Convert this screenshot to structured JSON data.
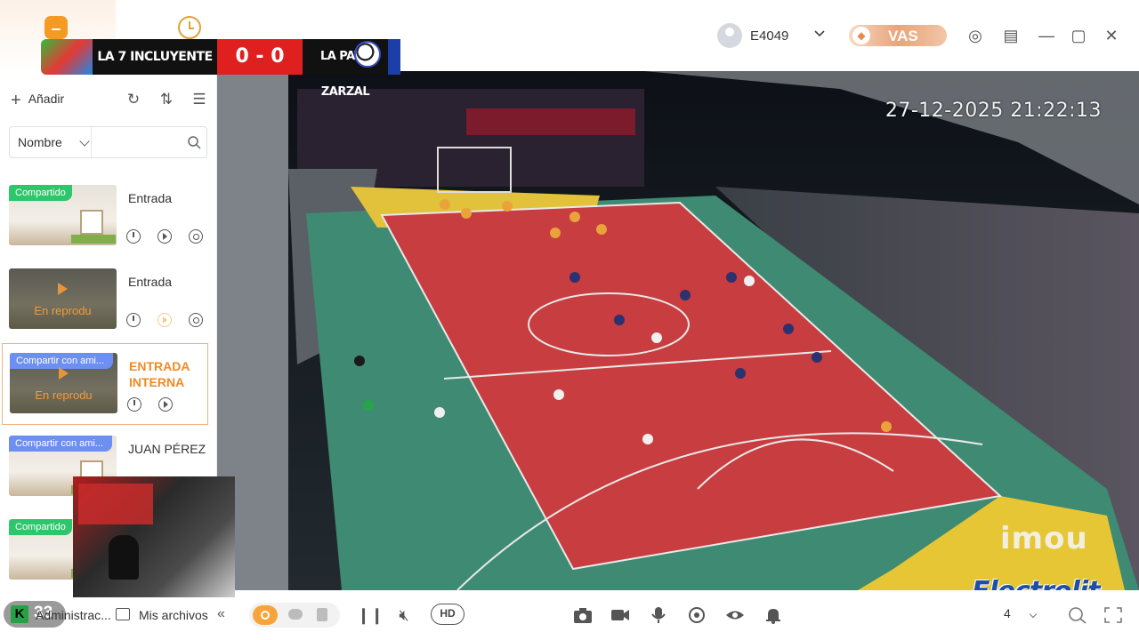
{
  "scoreboard": {
    "team_home": "LA 7 INCLUYENTE",
    "score": "0 - 0",
    "team_away": "LA PAVA ZARZAL"
  },
  "header": {
    "username": "E4049",
    "vas_label": "VAS"
  },
  "sidebar": {
    "add_label": "Añadir",
    "filter_label": "Nombre",
    "search_placeholder": "",
    "devices": [
      {
        "name": "Entrada",
        "tag": "Compartido",
        "overlay": "",
        "state": "idle"
      },
      {
        "name": "Entrada",
        "tag": "",
        "overlay": "En reprodu",
        "state": "playing"
      },
      {
        "name": "ENTRADA INTERNA",
        "tag": "Compartir con ami...",
        "overlay": "En reprodu",
        "state": "selected"
      },
      {
        "name": "JUAN PÉREZ",
        "tag": "Compartir con ami...",
        "overlay": "",
        "state": "idle"
      },
      {
        "name": "",
        "tag": "Compartido",
        "overlay": "",
        "state": "idle"
      }
    ]
  },
  "video": {
    "timestamp": "27-12-2025 21:22:13",
    "watermark": "imou",
    "sponsor": "Electrolit"
  },
  "bottombar": {
    "counter": "33",
    "counter_letter": "K",
    "admin_label": "Administrac...",
    "files_label": "Mis archivos",
    "quality_label": "HD",
    "grid_value": "4"
  },
  "colors": {
    "accent": "#f7a43d",
    "shared_tag": "#2dc66b",
    "friend_tag": "#6d8ff2",
    "score_red": "#e0201e"
  }
}
